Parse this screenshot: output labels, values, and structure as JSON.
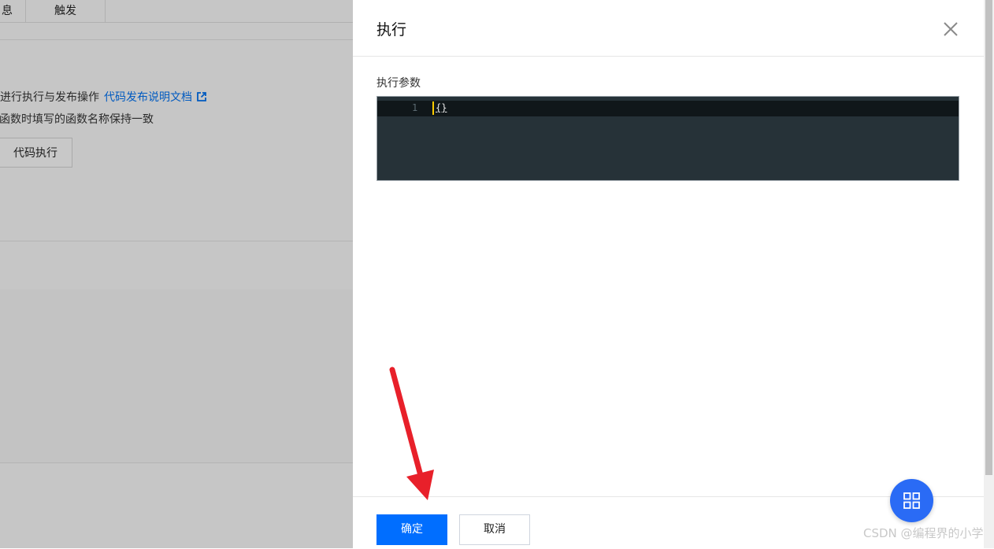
{
  "background": {
    "tabs": [
      {
        "label": "息"
      },
      {
        "label": "触发"
      }
    ],
    "description_line1": "再进行执行与发布操作",
    "doc_link": "代码发布说明文档",
    "description_line2": "函数时填写的函数名称保持一致",
    "run_button": "代码执行"
  },
  "drawer": {
    "title": "执行",
    "param_label": "执行参数",
    "editor": {
      "line_number": "1",
      "code": "{}"
    },
    "ok_button": "确定",
    "cancel_button": "取消"
  },
  "watermark": "CSDN @编程界的小学生",
  "colors": {
    "primary": "#006eff",
    "editor_bg": "#263238",
    "fab": "#2a6bf5",
    "annotation_arrow": "#e8202a"
  },
  "icons": {
    "close": "close-icon",
    "external_link": "external-link-icon",
    "fab": "grid-icon"
  }
}
